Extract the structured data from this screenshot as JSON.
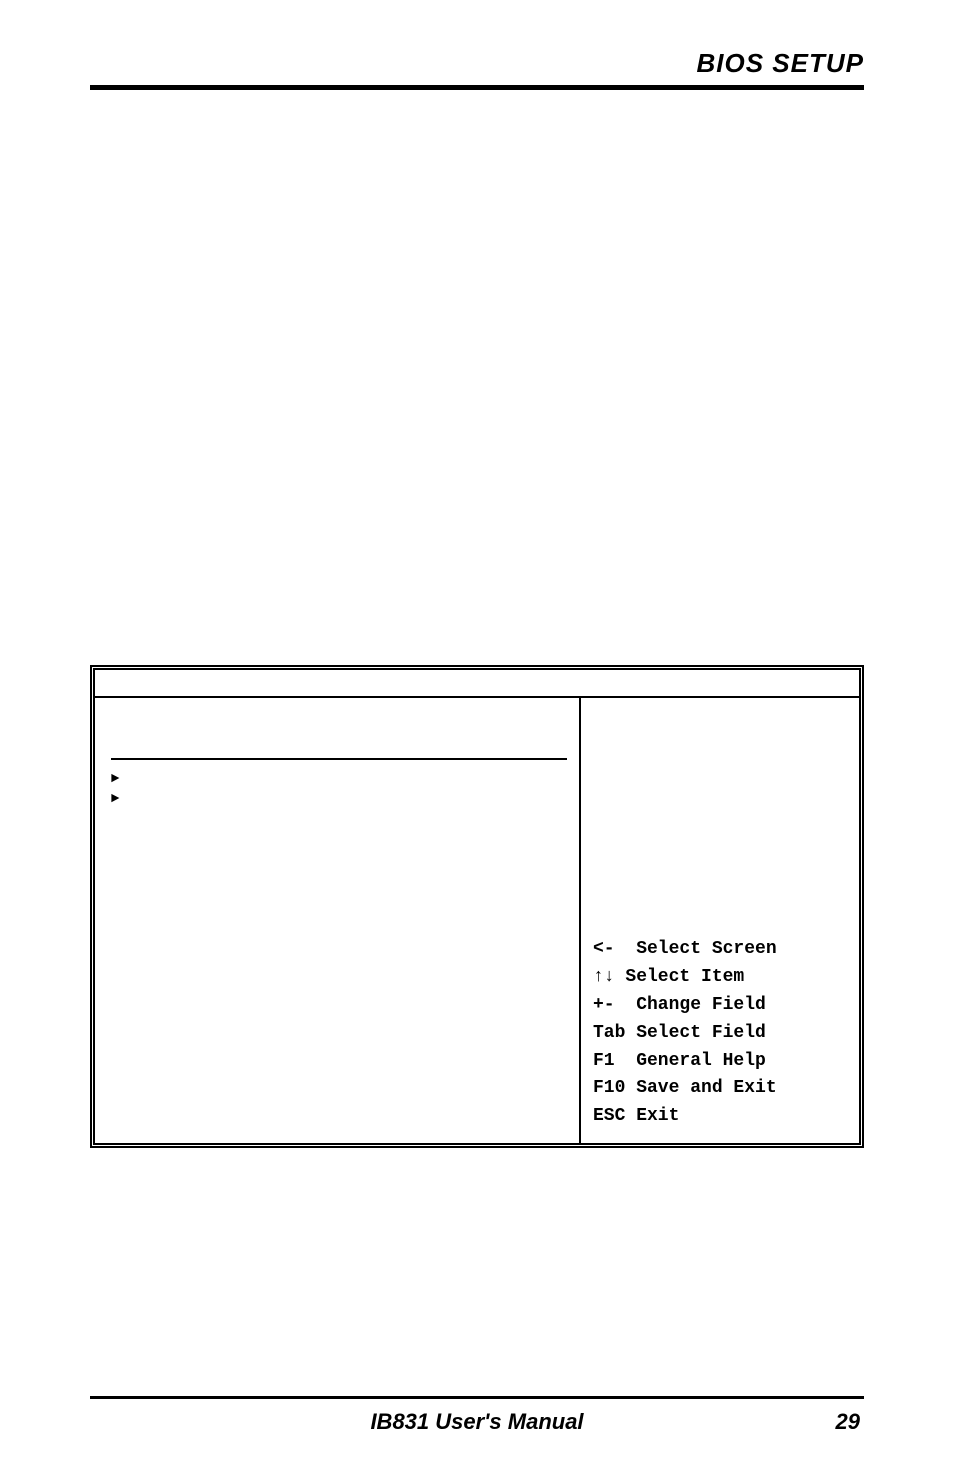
{
  "header": {
    "title": "BIOS SETUP"
  },
  "bios": {
    "arrow1": "►",
    "arrow2": "►",
    "hints": {
      "select_screen": "<-  Select Screen",
      "select_item": "↑↓ Select Item",
      "change_field": "+-  Change Field",
      "select_field": "Tab Select Field",
      "general_help": "F1  General Help",
      "save_exit": "F10 Save and Exit",
      "esc_exit": "ESC Exit"
    }
  },
  "footer": {
    "manual_title": "IB831 User's Manual",
    "page_number": "29"
  }
}
